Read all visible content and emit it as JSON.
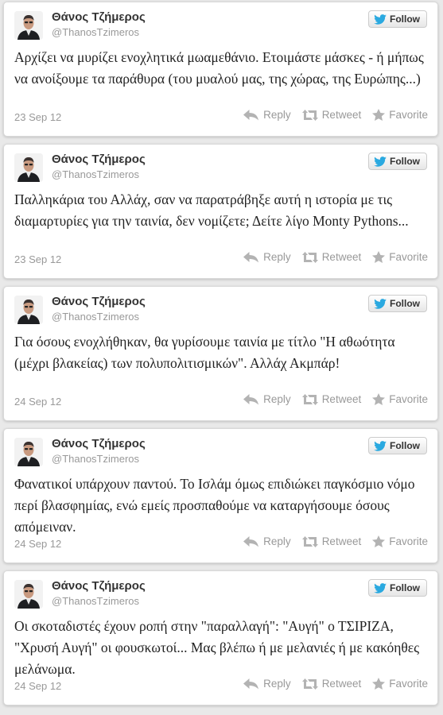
{
  "actions": {
    "follow_label": "Follow",
    "reply_label": "Reply",
    "retweet_label": "Retweet",
    "favorite_label": "Favorite"
  },
  "colors": {
    "twitter_blue": "#2aa9e0",
    "icon_gray": "#b3b3b3"
  },
  "icons": [
    "twitter-bird-icon",
    "reply-icon",
    "retweet-icon",
    "favorite-star-icon"
  ],
  "tweets": [
    {
      "name": "Θάνος Τζήμερος",
      "handle": "@ThanosTzimeros",
      "text": "Αρχίζει να μυρίζει ενοχλητικά μωαμεθάνιο. Ετοιμάστε μάσκες - ή μήπως να ανοίξουμε τα παράθυρα (του μυαλού μας, της χώρας, της Ευρώπης...)",
      "date": "23 Sep 12"
    },
    {
      "name": "Θάνος Τζήμερος",
      "handle": "@ThanosTzimeros",
      "text": "Παλληκάρια του Αλλάχ, σαν να παρατράβηξε αυτή η ιστορία με τις διαμαρτυρίες για την ταινία, δεν νομίζετε; Δείτε λίγο Monty Pythons...",
      "date": "23 Sep 12"
    },
    {
      "name": "Θάνος Τζήμερος",
      "handle": "@ThanosTzimeros",
      "text": "Για όσους ενοχλήθηκαν, θα γυρίσουμε ταινία με τίτλο \"Η αθωότητα (μέχρι βλακείας) των πολυπολιτισμικών\". Αλλάχ Ακμπάρ!",
      "date": "24 Sep 12"
    },
    {
      "name": "Θάνος Τζήμερος",
      "handle": "@ThanosTzimeros",
      "text": "Φανατικοί υπάρχουν παντού. Το Ισλάμ όμως επιδιώκει παγκόσμιο νόμο περί βλασφημίας, ενώ εμείς προσπαθούμε να καταργήσουμε όσους απόμειναν.",
      "date": "24 Sep 12"
    },
    {
      "name": "Θάνος Τζήμερος",
      "handle": "@ThanosTzimeros",
      "text": "Οι σκοταδιστές έχουν ροπή στην \"παραλλαγή\": \"Αυγή\" ο ΤΣΙΡΙΖΑ, \"Χρυσή Αυγή\" οι φουσκωτοί... Μας βλέπω ή με μελανιές ή με κακόηθες μελάνωμα.",
      "date": "24 Sep 12"
    }
  ]
}
